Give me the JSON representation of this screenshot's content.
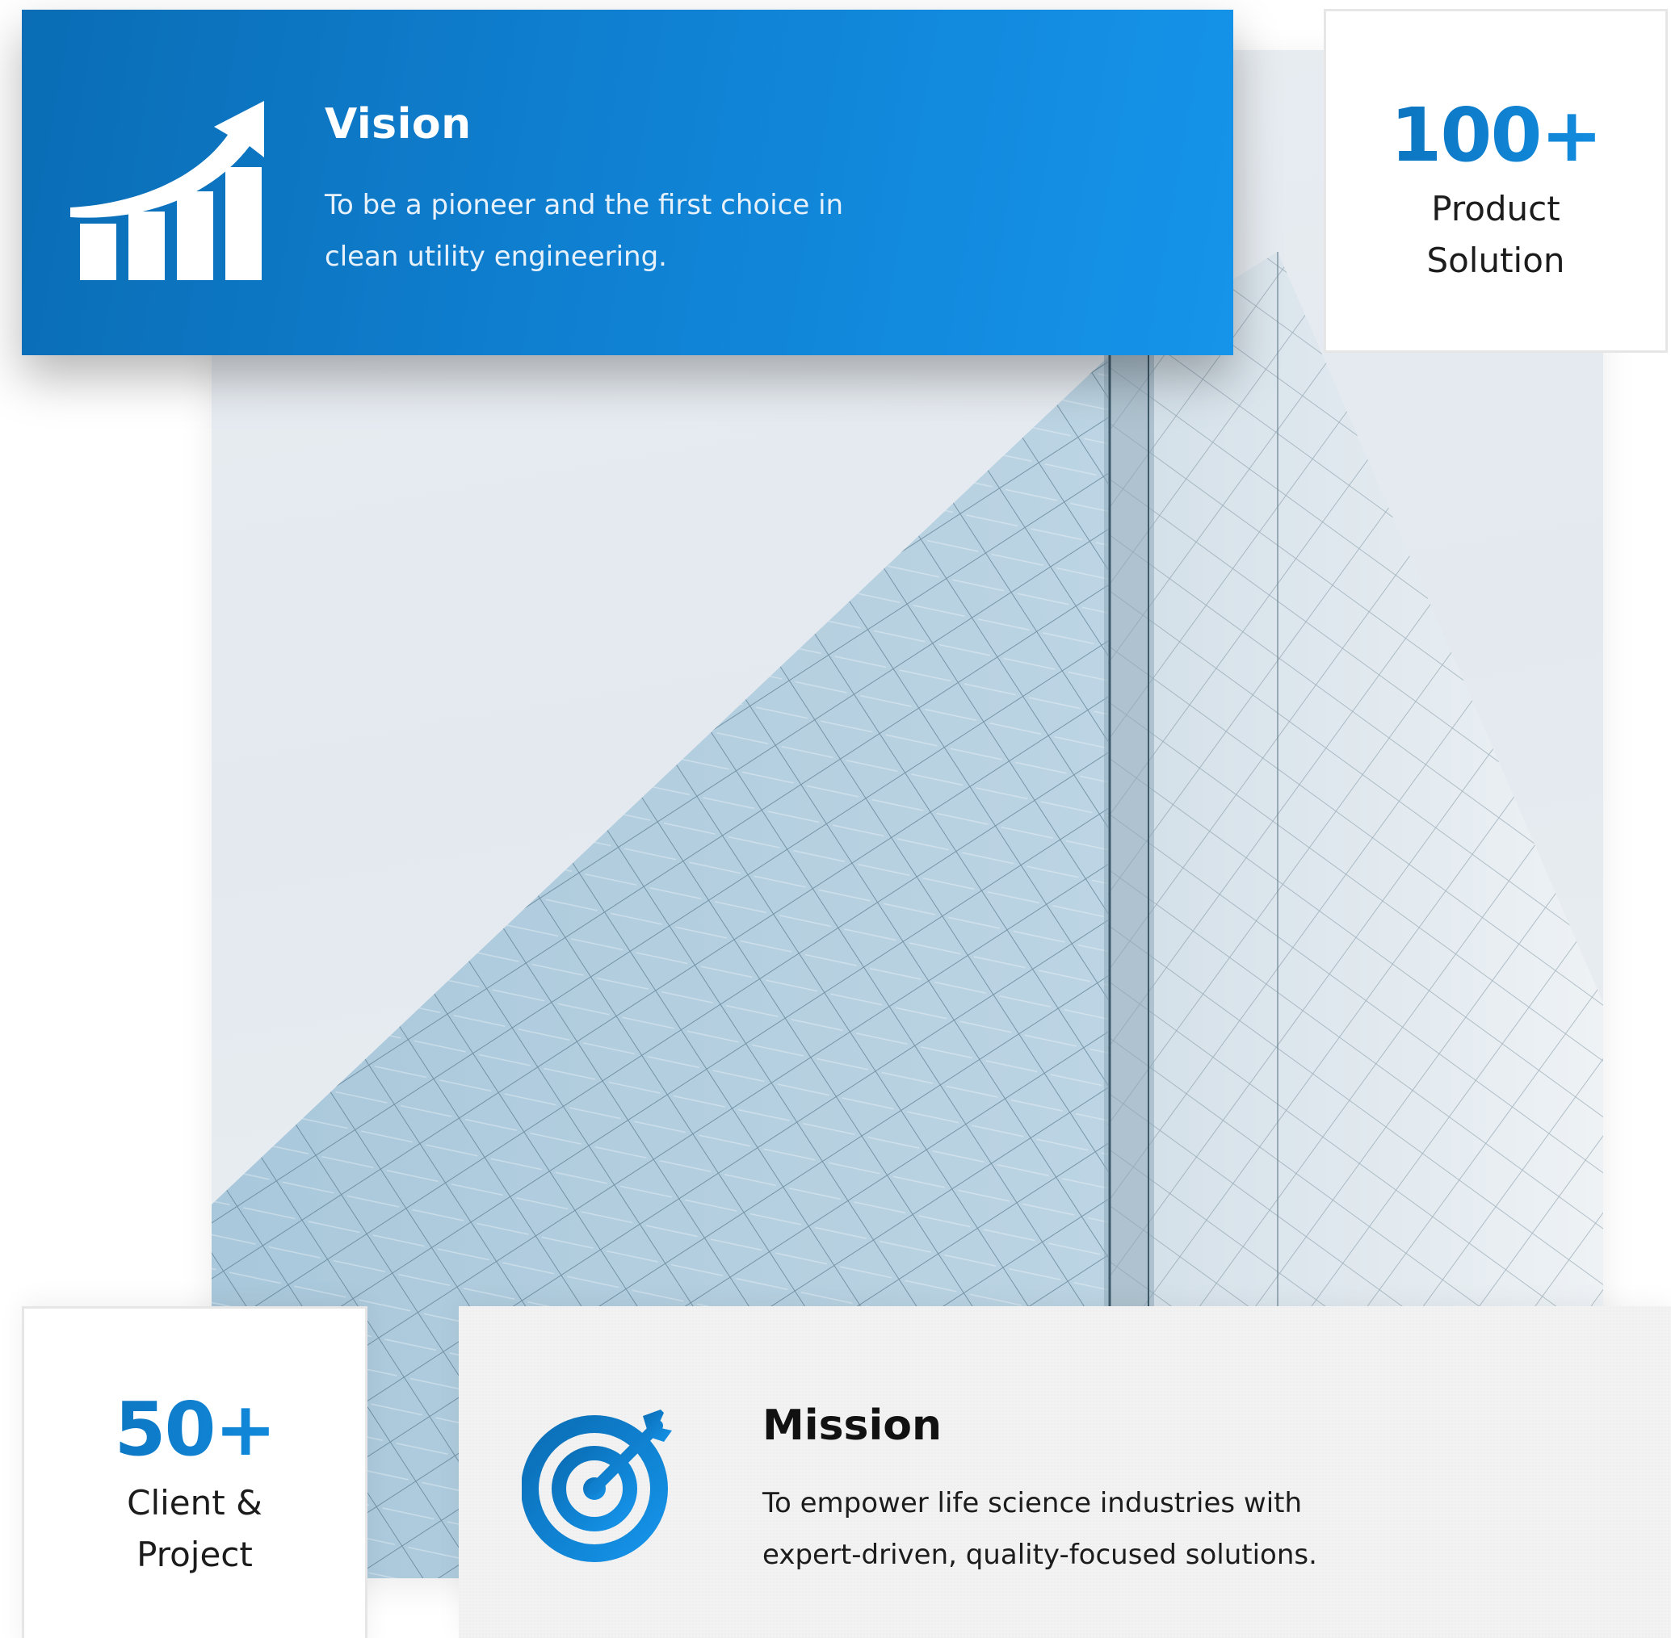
{
  "vision": {
    "title": "Vision",
    "text": "To be a pioneer and the first choice in clean utility engineering.",
    "icon": "growth-chart-icon"
  },
  "mission": {
    "title": "Mission",
    "text": "To empower life science industries with expert-driven, quality-focused solutions.",
    "icon": "target-icon"
  },
  "stats": {
    "products": {
      "number": "100+",
      "label": "Product Solution"
    },
    "clients": {
      "number": "50+",
      "label": "Client & Project"
    }
  },
  "colors": {
    "brand_blue_dark": "#0a6db5",
    "brand_blue_light": "#1594ea",
    "mission_bg": "#f2f2f2"
  }
}
